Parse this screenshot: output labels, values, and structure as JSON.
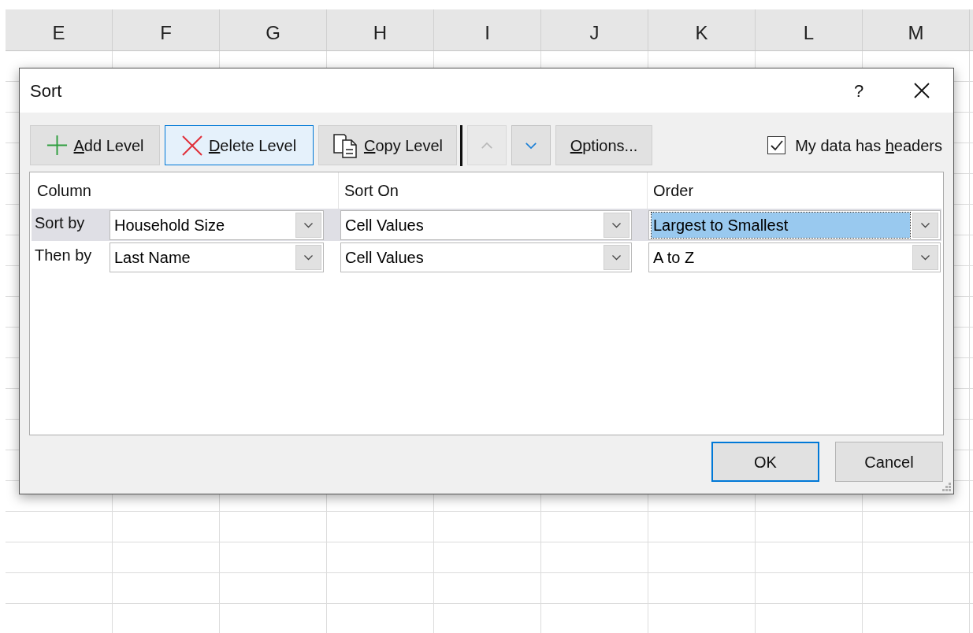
{
  "sheet": {
    "columns": [
      "E",
      "F",
      "G",
      "H",
      "I",
      "J",
      "K",
      "L",
      "M"
    ]
  },
  "dialog": {
    "title": "Sort",
    "help": "?",
    "toolbar": [
      {
        "kind": "add",
        "key": "A",
        "post": "dd Level",
        "selected": false
      },
      {
        "kind": "delete",
        "key": "D",
        "post": "elete Level",
        "selected": true
      },
      {
        "kind": "copy",
        "key": "C",
        "post": "opy Level",
        "selected": false
      },
      {
        "kind": "up",
        "disabled": true
      },
      {
        "kind": "down",
        "disabled": false
      },
      {
        "kind": "options",
        "key": "O",
        "post": "ptions...",
        "selected": false
      }
    ],
    "headers_checkbox": {
      "pre": "My data has ",
      "key": "h",
      "post": "eaders",
      "checked": true
    },
    "columns": [
      "Column",
      "Sort On",
      "Order"
    ],
    "levels": [
      {
        "label": "Sort by",
        "column": "Household Size",
        "sort_on": "Cell Values",
        "order": "Largest to Smallest",
        "selected": true
      },
      {
        "label": "Then by",
        "column": "Last Name",
        "sort_on": "Cell Values",
        "order": "A to Z",
        "selected": false
      }
    ],
    "buttons": [
      {
        "label": "OK",
        "default": true
      },
      {
        "label": "Cancel",
        "default": false
      }
    ]
  }
}
